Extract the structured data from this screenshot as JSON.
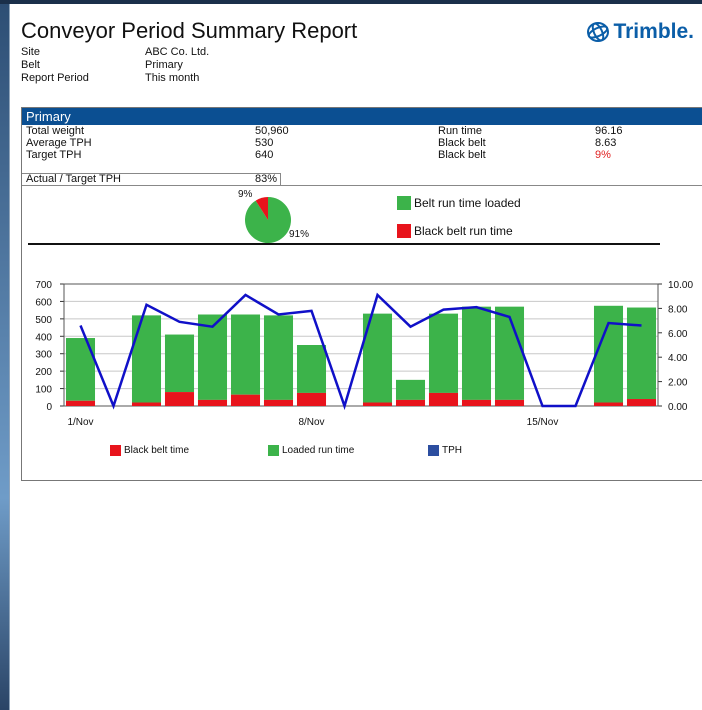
{
  "report": {
    "title": "Conveyor Period Summary Report",
    "logo_text": "Trimble.",
    "meta": [
      {
        "label": "Site",
        "value": "ABC Co. Ltd."
      },
      {
        "label": "Belt",
        "value": "Primary"
      },
      {
        "label": "Report Period",
        "value": "This month"
      }
    ]
  },
  "panel": {
    "header": "Primary",
    "stats": {
      "total_weight_label": "Total weight",
      "total_weight": "50,960",
      "avg_tph_label": "Average TPH",
      "avg_tph": "530",
      "target_tph_label": "Target TPH",
      "target_tph": "640",
      "actual_target_label": "Actual / Target TPH",
      "actual_target": "83%",
      "run_time_label": "Run time",
      "run_time": "96.16",
      "black_belt_label": "Black belt",
      "black_belt_hours": "8.63",
      "black_belt_pct_label": "Black belt",
      "black_belt_pct": "9%"
    },
    "pie": {
      "loaded_label": "Belt run time loaded",
      "black_label": "Black belt run time",
      "loaded_pct_text": "91%",
      "black_pct_text": "9%",
      "loaded_value": 91,
      "black_value": 9
    },
    "legend": {
      "black_belt_time": "Black belt time",
      "loaded_run_time": "Loaded run time",
      "tph": "TPH"
    }
  },
  "colors": {
    "header_blue": "#0b4f92",
    "green": "#3cb34a",
    "red": "#e8141c",
    "tph_line": "#1010c8",
    "legend_tph": "#2c4ea0"
  },
  "chart_data": {
    "type": "bar",
    "stacked": true,
    "x": [
      1,
      2,
      3,
      4,
      5,
      6,
      7,
      8,
      9,
      10,
      11,
      12,
      13,
      14,
      15,
      16,
      17,
      18
    ],
    "x_tick_labels": [
      {
        "day": 1,
        "label": "1/Nov"
      },
      {
        "day": 8,
        "label": "8/Nov"
      },
      {
        "day": 15,
        "label": "15/Nov"
      }
    ],
    "left_axis": {
      "ylim": [
        0,
        700
      ],
      "ticks": [
        "0",
        "100",
        "200",
        "300",
        "400",
        "500",
        "600",
        "700"
      ]
    },
    "right_axis": {
      "ylim": [
        0,
        10
      ],
      "ticks": [
        "0.00",
        "2.00",
        "4.00",
        "6.00",
        "8.00",
        "10.00"
      ]
    },
    "series": [
      {
        "name": "Black belt time",
        "axis": "left",
        "values": [
          30,
          0,
          20,
          80,
          35,
          65,
          35,
          75,
          0,
          20,
          35,
          75,
          35,
          35,
          0,
          0,
          20,
          40
        ]
      },
      {
        "name": "Loaded run time",
        "axis": "left",
        "values": [
          360,
          0,
          500,
          330,
          490,
          460,
          485,
          275,
          0,
          510,
          115,
          455,
          535,
          535,
          0,
          0,
          555,
          525
        ]
      },
      {
        "name": "TPH",
        "axis": "right",
        "type": "line",
        "values": [
          6.6,
          0,
          8.3,
          6.9,
          6.5,
          9.1,
          7.5,
          7.8,
          0,
          9.1,
          6.5,
          7.9,
          8.1,
          7.3,
          0,
          0,
          6.8,
          6.6
        ]
      }
    ],
    "grid": true
  }
}
